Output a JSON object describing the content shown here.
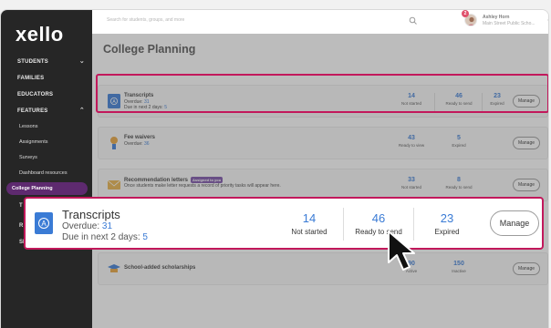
{
  "app": {
    "logo": "xello"
  },
  "header": {
    "search_placeholder": "Search for students, groups, and more",
    "user_name": "Ashley Horn",
    "user_school": "Main Street Public Scho...",
    "notification_count": "2"
  },
  "sidebar": {
    "items": [
      {
        "label": "STUDENTS",
        "chev": "⌄"
      },
      {
        "label": "FAMILIES",
        "chev": ""
      },
      {
        "label": "EDUCATORS",
        "chev": ""
      },
      {
        "label": "FEATURES",
        "chev": "⌃"
      }
    ],
    "sub_items": [
      {
        "label": "Lessons"
      },
      {
        "label": "Assignments"
      },
      {
        "label": "Surveys"
      },
      {
        "label": "Dashboard resources"
      },
      {
        "label": "College Planning"
      }
    ],
    "partial_letters": [
      "T",
      "R",
      "SE"
    ]
  },
  "main": {
    "page_title": "College Planning",
    "cards": [
      {
        "title": "Transcripts",
        "line2_label": "Overdue: ",
        "line2_value": "31",
        "line3_label": "Due in next 2 days: ",
        "line3_value": "5",
        "stats": [
          {
            "num": "14",
            "label": "Not started"
          },
          {
            "num": "46",
            "label": "Ready to send"
          },
          {
            "num": "23",
            "label": "Expired"
          }
        ],
        "manage": "Manage"
      },
      {
        "title": "Fee waivers",
        "line2_label": "Overdue: ",
        "line2_value": "36",
        "stats": [
          {
            "num": "43",
            "label": "Ready to view"
          },
          {
            "num": "5",
            "label": "Expired"
          }
        ],
        "manage": "Manage"
      },
      {
        "title": "Recommendation letters",
        "tag": "Assigned to you",
        "line2_label": "Once students make letter requests a record of priority tasks will appear here.",
        "stats": [
          {
            "num": "33",
            "label": "Not started"
          },
          {
            "num": "8",
            "label": "Ready to send"
          }
        ],
        "manage": "Manage"
      },
      {
        "title": "School-added scholarships",
        "stats": [
          {
            "num": "90",
            "label": "Active"
          },
          {
            "num": "150",
            "label": "Inactive"
          }
        ],
        "manage": "Manage"
      }
    ]
  },
  "zoom": {
    "title": "Transcripts",
    "overdue_label": "Overdue: ",
    "overdue_value": "31",
    "due_label": "Due in next 2 days: ",
    "due_value": "5",
    "stats": [
      {
        "num": "14",
        "label": "Not started"
      },
      {
        "num": "46",
        "label": "Ready to send"
      },
      {
        "num": "23",
        "label": "Expired"
      }
    ],
    "manage": "Manage"
  },
  "colors": {
    "highlight": "#c2185b",
    "accent": "#3a7bd5",
    "sidebar_bg": "#262626",
    "active_nav": "#5e2a6f"
  }
}
